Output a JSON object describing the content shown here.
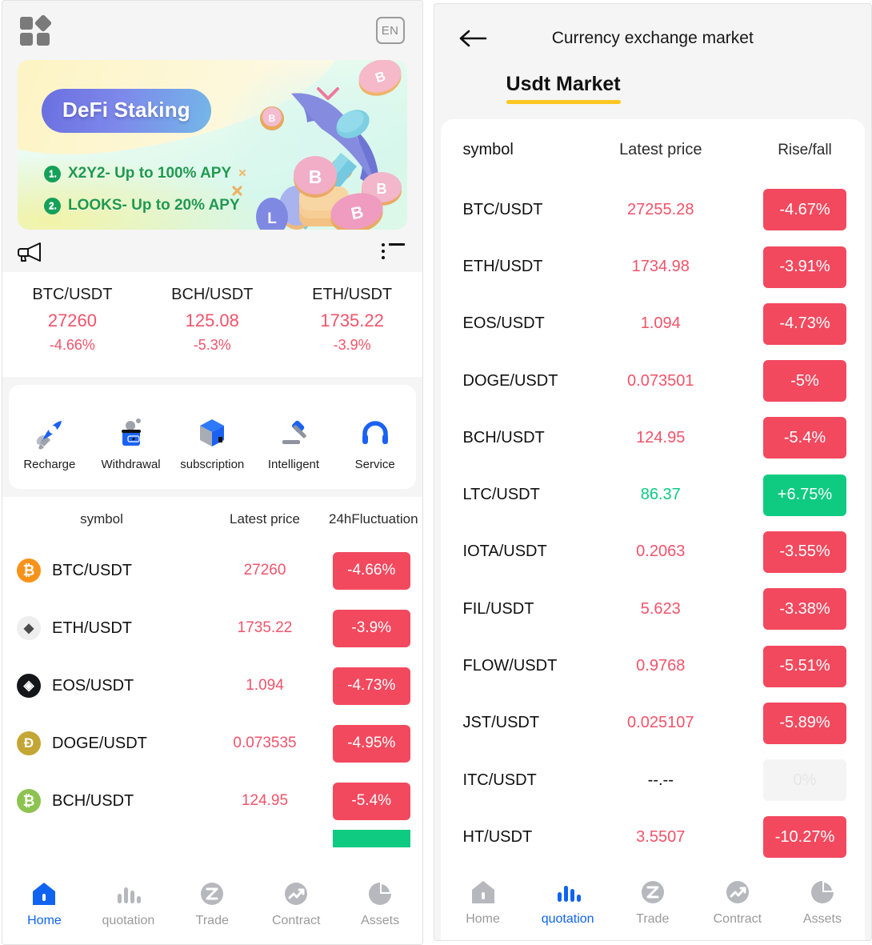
{
  "left": {
    "topbar": {
      "logo": "grid-logo",
      "lang_label": "EN"
    },
    "banner": {
      "title": "DeFi Staking",
      "line1_num": "1.",
      "line1": "X2Y2- Up to 100% APY",
      "line2_num": "2.",
      "line2": "LOOKS- Up to 20% APY"
    },
    "notice": {
      "megaphone": "megaphone-icon",
      "list": "list-icon",
      "text": ""
    },
    "tickers": [
      {
        "symbol": "BTC/USDT",
        "price": "27260",
        "change": "-4.66%"
      },
      {
        "symbol": "BCH/USDT",
        "price": "125.08",
        "change": "-5.3%"
      },
      {
        "symbol": "ETH/USDT",
        "price": "1735.22",
        "change": "-3.9%"
      }
    ],
    "quick_actions": [
      {
        "label": "Recharge",
        "icon": "rocket-icon"
      },
      {
        "label": "Withdrawal",
        "icon": "wallet-icon"
      },
      {
        "label": "subscription",
        "icon": "cube-icon"
      },
      {
        "label": "Intelligent",
        "icon": "gavel-icon"
      },
      {
        "label": "Service",
        "icon": "headset-icon"
      }
    ],
    "market": {
      "headers": {
        "symbol": "symbol",
        "price": "Latest price",
        "change": "24hFluctuation"
      },
      "rows": [
        {
          "symbol": "BTC/USDT",
          "price": "27260",
          "change": "-4.66%",
          "dir": "down",
          "coin": "₿",
          "coin_bg": "#f7931a",
          "coin_fg": "#ffffff"
        },
        {
          "symbol": "ETH/USDT",
          "price": "1735.22",
          "change": "-3.9%",
          "dir": "down",
          "coin": "◆",
          "coin_bg": "#eeeeee",
          "coin_fg": "#4a4a4a"
        },
        {
          "symbol": "EOS/USDT",
          "price": "1.094",
          "change": "-4.73%",
          "dir": "down",
          "coin": "◈",
          "coin_bg": "#14161a",
          "coin_fg": "#ffffff"
        },
        {
          "symbol": "DOGE/USDT",
          "price": "0.073535",
          "change": "-4.95%",
          "dir": "down",
          "coin": "Đ",
          "coin_bg": "#c3a634",
          "coin_fg": "#ffffff"
        },
        {
          "symbol": "BCH/USDT",
          "price": "124.95",
          "change": "-5.4%",
          "dir": "down",
          "coin": "₿",
          "coin_bg": "#8dc351",
          "coin_fg": "#ffffff"
        }
      ]
    },
    "nav": [
      {
        "label": "Home",
        "icon": "home-icon",
        "active": true
      },
      {
        "label": "quotation",
        "icon": "bars-icon",
        "active": false
      },
      {
        "label": "Trade",
        "icon": "trade-icon",
        "active": false
      },
      {
        "label": "Contract",
        "icon": "contract-icon",
        "active": false
      },
      {
        "label": "Assets",
        "icon": "assets-icon",
        "active": false
      }
    ]
  },
  "right": {
    "topbar": {
      "back": "back-arrow-icon",
      "title": "Currency exchange market"
    },
    "tab": {
      "label": "Usdt Market",
      "underline_color": "#ffc721"
    },
    "market": {
      "headers": {
        "symbol": "symbol",
        "price": "Latest price",
        "change": "Rise/fall"
      },
      "rows": [
        {
          "symbol": "BTC/USDT",
          "price": "27255.28",
          "change": "-4.67%",
          "dir": "down"
        },
        {
          "symbol": "ETH/USDT",
          "price": "1734.98",
          "change": "-3.91%",
          "dir": "down"
        },
        {
          "symbol": "EOS/USDT",
          "price": "1.094",
          "change": "-4.73%",
          "dir": "down"
        },
        {
          "symbol": "DOGE/USDT",
          "price": "0.073501",
          "change": "-5%",
          "dir": "down"
        },
        {
          "symbol": "BCH/USDT",
          "price": "124.95",
          "change": "-5.4%",
          "dir": "down"
        },
        {
          "symbol": "LTC/USDT",
          "price": "86.37",
          "change": "+6.75%",
          "dir": "up"
        },
        {
          "symbol": "IOTA/USDT",
          "price": "0.2063",
          "change": "-3.55%",
          "dir": "down"
        },
        {
          "symbol": "FIL/USDT",
          "price": "5.623",
          "change": "-3.38%",
          "dir": "down"
        },
        {
          "symbol": "FLOW/USDT",
          "price": "0.9768",
          "change": "-5.51%",
          "dir": "down"
        },
        {
          "symbol": "JST/USDT",
          "price": "0.025107",
          "change": "-5.89%",
          "dir": "down"
        },
        {
          "symbol": "ITC/USDT",
          "price": "--.--",
          "change": "0%",
          "dir": "flat"
        },
        {
          "symbol": "HT/USDT",
          "price": "3.5507",
          "change": "-10.27%",
          "dir": "down"
        }
      ]
    },
    "nav": [
      {
        "label": "Home",
        "icon": "home-icon",
        "active": false
      },
      {
        "label": "quotation",
        "icon": "bars-icon",
        "active": true
      },
      {
        "label": "Trade",
        "icon": "trade-icon",
        "active": false
      },
      {
        "label": "Contract",
        "icon": "contract-icon",
        "active": false
      },
      {
        "label": "Assets",
        "icon": "assets-icon",
        "active": false
      }
    ]
  },
  "colors": {
    "up": "#0ecb81",
    "down": "#f2495e",
    "accent": "#ffc721",
    "brand_blue": "#1063f0"
  }
}
